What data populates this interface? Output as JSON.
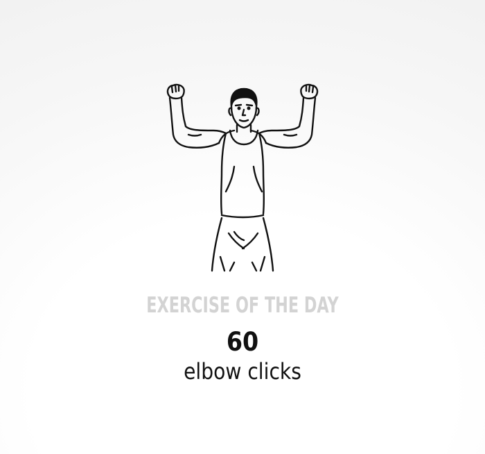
{
  "card": {
    "heading": "EXERCISE OF THE DAY",
    "count": "60",
    "exercise_name": "elbow clicks"
  },
  "illustration": {
    "icon": "man-flexing-arms-illustration",
    "line_color": "#111111"
  },
  "colors": {
    "heading": "#d3d3d3",
    "text": "#111111"
  }
}
